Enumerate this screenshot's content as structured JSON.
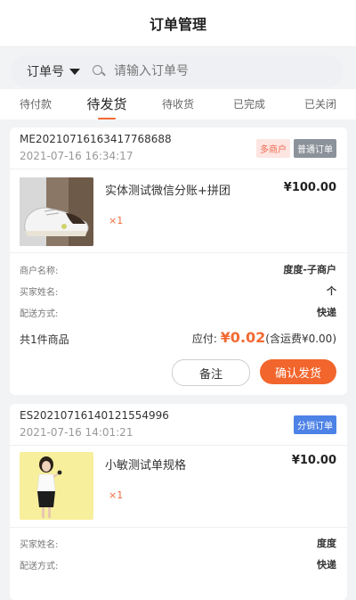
{
  "header": {
    "title": "订单管理"
  },
  "search": {
    "type_label": "订单号",
    "placeholder": "请输入订单号"
  },
  "tabs": [
    "待付款",
    "待发货",
    "待收货",
    "已完成",
    "已关闭"
  ],
  "orders": [
    {
      "order_no": "ME20210716163417768688",
      "time": "2021-07-16 16:34:17",
      "badges": [
        "多商户",
        "普通订单"
      ],
      "product_name": "实体测试微信分账+拼团",
      "price": "¥100.00",
      "qty": "×1",
      "info": [
        {
          "label": "商户名称:",
          "value": "度度-子商户"
        },
        {
          "label": "买家姓名:",
          "value": "个"
        },
        {
          "label": "配送方式:",
          "value": "快递"
        }
      ],
      "summary_count": "共1件商品",
      "pay_label": "应付: ",
      "pay_amount": "¥0.02",
      "pay_note": "(含运费¥0.00)",
      "btn_note": "备注",
      "btn_ship": "确认发货"
    },
    {
      "order_no": "ES20210716140121554996",
      "time": "2021-07-16 14:01:21",
      "badges": [
        "分销订单"
      ],
      "product_name": "小敏测试单规格",
      "price": "¥10.00",
      "qty": "×1",
      "info": [
        {
          "label": "买家姓名:",
          "value": "度度"
        },
        {
          "label": "配送方式:",
          "value": "快递"
        }
      ]
    }
  ],
  "colors": {
    "accent": "#f26a33",
    "page_bg": "#f2f3f5",
    "distribution_badge": "#4d82e6"
  }
}
